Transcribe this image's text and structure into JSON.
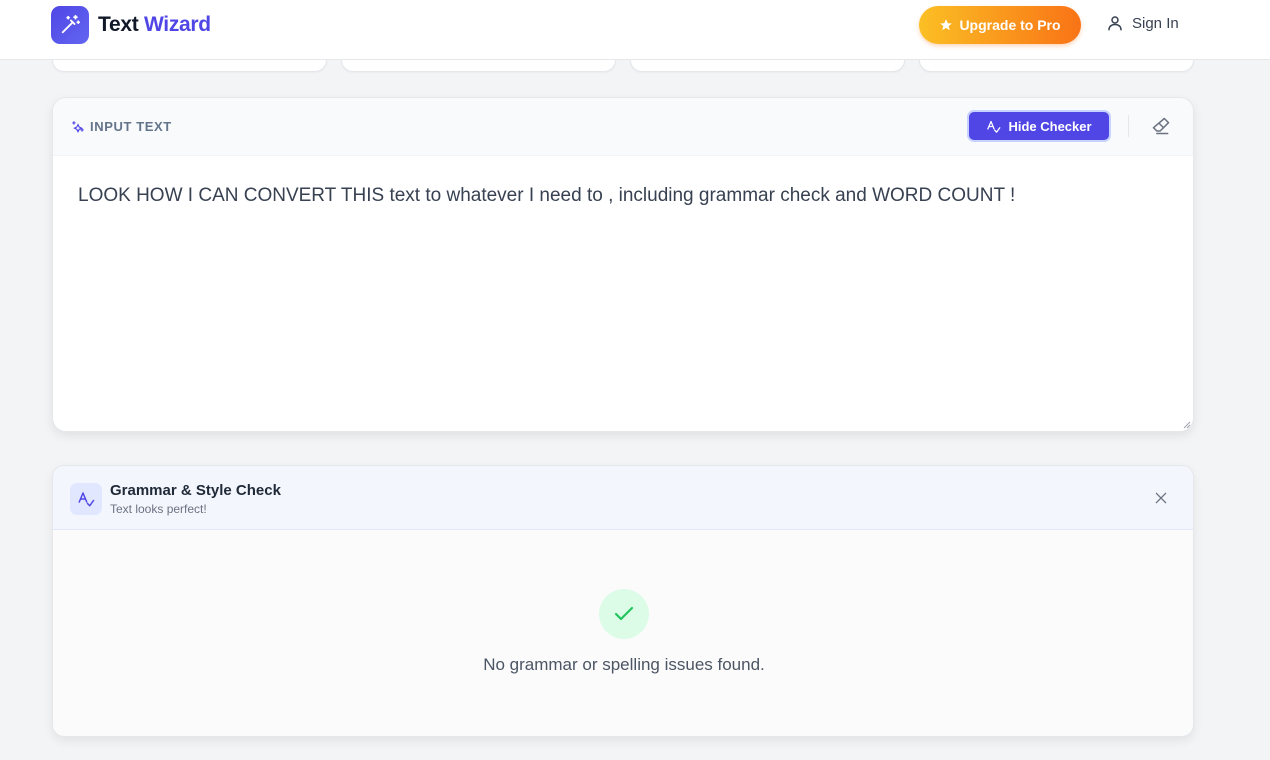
{
  "app": {
    "name_part1": "Text",
    "name_part2": "Wizard"
  },
  "header": {
    "upgrade_label": "Upgrade to Pro",
    "signin_label": "Sign In"
  },
  "input_panel": {
    "label": "INPUT TEXT",
    "hide_checker_label": "Hide Checker",
    "text": "LOOK HOW I CAN CONVERT THIS text to whatever I need to , including grammar check and WORD COUNT !"
  },
  "grammar_panel": {
    "title": "Grammar & Style Check",
    "subtitle": "Text looks perfect!",
    "empty_message": "No grammar or spelling issues found."
  },
  "colors": {
    "brand": "#4f46e5",
    "upgrade_gradient_start": "#fbbf24",
    "upgrade_gradient_end": "#f97316",
    "success": "#22c55e"
  },
  "icons": {
    "logo": "magic-wand-icon",
    "upgrade": "star-icon",
    "signin": "user-icon",
    "input_label": "sparkles-icon",
    "hide_checker": "spell-check-icon",
    "clear": "eraser-icon",
    "grammar": "spell-check-icon",
    "close": "close-icon",
    "success": "check-icon"
  }
}
